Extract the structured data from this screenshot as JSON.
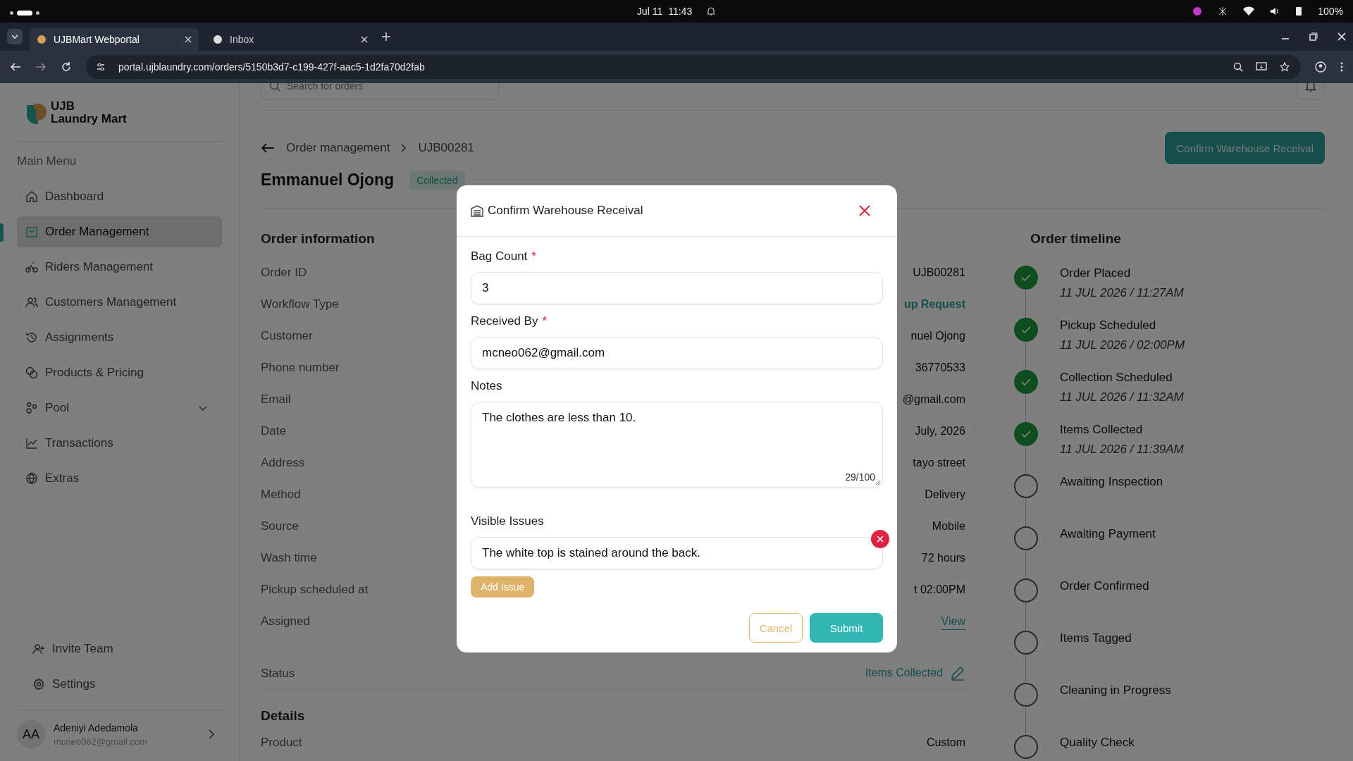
{
  "system_bar": {
    "date": "Jul 11",
    "time": "11:43",
    "battery": "100%"
  },
  "browser": {
    "tabs": [
      {
        "title": "UJBMart Webportal",
        "selected": true
      },
      {
        "title": "Inbox",
        "selected": false
      }
    ],
    "url": "portal.ujblaundry.com/orders/5150b3d7-c199-427f-aac5-1d2fa70d2fab"
  },
  "sidebar": {
    "brand": [
      "UJB",
      "Laundry Mart"
    ],
    "menu_heading": "Main Menu",
    "items": [
      {
        "label": "Dashboard",
        "selected": false,
        "expandable": false
      },
      {
        "label": "Order Management",
        "selected": true,
        "expandable": false
      },
      {
        "label": "Riders Management",
        "selected": false,
        "expandable": false
      },
      {
        "label": "Customers Management",
        "selected": false,
        "expandable": false
      },
      {
        "label": "Assignments",
        "selected": false,
        "expandable": false
      },
      {
        "label": "Products & Pricing",
        "selected": false,
        "expandable": false
      },
      {
        "label": "Pool",
        "selected": false,
        "expandable": true
      },
      {
        "label": "Transactions",
        "selected": false,
        "expandable": false
      },
      {
        "label": "Extras",
        "selected": false,
        "expandable": false
      }
    ],
    "footer_items": [
      "Invite Team",
      "Settings"
    ],
    "user": {
      "initials": "AA",
      "name": "Adeniyi Adedamola",
      "email": "mcneo062@gmail.com"
    }
  },
  "header": {
    "search_placeholder": "Search for orders"
  },
  "page": {
    "breadcrumb": [
      "Order management",
      "UJB00281"
    ],
    "title": "Emmanuel Ojong",
    "status_badge": "Collected",
    "primary_button": "Confirm Warehouse Receival"
  },
  "order_information": {
    "heading": "Order information",
    "rows": [
      {
        "label": "Order ID",
        "value": "UJB00281",
        "kind": "text"
      },
      {
        "label": "Workflow Type",
        "value": "up Request",
        "kind": "accent"
      },
      {
        "label": "Customer",
        "value": "nuel Ojong",
        "kind": "text"
      },
      {
        "label": "Phone number",
        "value": "36770533",
        "kind": "text"
      },
      {
        "label": "Email",
        "value": "@gmail.com",
        "kind": "text"
      },
      {
        "label": "Date",
        "value": "July, 2026",
        "kind": "text"
      },
      {
        "label": "Address",
        "value": "tayo street",
        "kind": "text"
      },
      {
        "label": "Method",
        "value": "Delivery",
        "kind": "text"
      },
      {
        "label": "Source",
        "value": "Mobile",
        "kind": "text"
      },
      {
        "label": "Wash time",
        "value": "72 hours",
        "kind": "text"
      },
      {
        "label": "Pickup scheduled at",
        "value": "t 02:00PM",
        "kind": "text"
      },
      {
        "label": "Assigned",
        "value": "View",
        "kind": "link"
      },
      {
        "label": "Status",
        "value": "Items Collected",
        "kind": "editable"
      }
    ]
  },
  "details": {
    "heading": "Details",
    "rows": [
      {
        "label": "Product",
        "value": "Custom"
      }
    ]
  },
  "timeline": {
    "heading": "Order timeline",
    "items": [
      {
        "label": "Order Placed",
        "time": "11 JUL 2026 / 11:27AM",
        "done": true
      },
      {
        "label": "Pickup Scheduled",
        "time": "11 JUL 2026 / 02:00PM",
        "done": true
      },
      {
        "label": "Collection Scheduled",
        "time": "11 JUL 2026 / 11:32AM",
        "done": true
      },
      {
        "label": "Items Collected",
        "time": "11 JUL 2026 / 11:39AM",
        "done": true
      },
      {
        "label": "Awaiting Inspection",
        "done": false
      },
      {
        "label": "Awaiting Payment",
        "done": false
      },
      {
        "label": "Order Confirmed",
        "done": false
      },
      {
        "label": "Items Tagged",
        "done": false
      },
      {
        "label": "Cleaning in Progress",
        "done": false
      },
      {
        "label": "Quality Check",
        "done": false
      }
    ]
  },
  "modal": {
    "title": "Confirm Warehouse Receival",
    "fields": [
      {
        "label": "Bag Count",
        "required_mark": "*",
        "value": "3",
        "kind": "input"
      },
      {
        "label": "Received By",
        "required_mark": "*",
        "value": "mcneo062@gmail.com",
        "kind": "input"
      },
      {
        "label": "Notes",
        "value": "The clothes are less than 10.",
        "kind": "textarea",
        "counter": "29/100"
      }
    ],
    "issues": {
      "label": "Visible Issues",
      "items": [
        "The white top is stained around the back."
      ],
      "add_button": "Add Issue"
    },
    "cancel": "Cancel",
    "submit": "Submit"
  }
}
